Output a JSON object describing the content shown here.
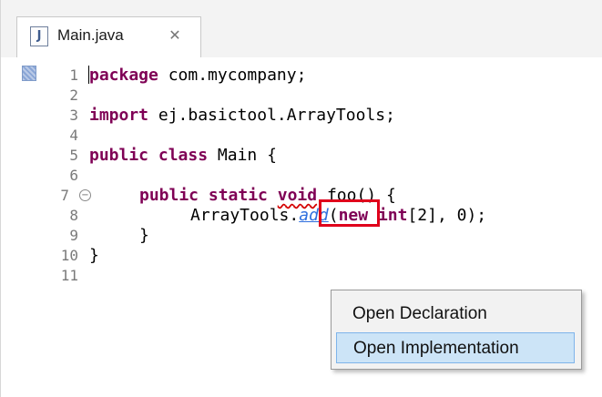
{
  "tab": {
    "icon": "java-file-icon",
    "icon_glyph": "J",
    "label": "Main.java",
    "close_icon": "close-x-icon",
    "close_glyph": "✕"
  },
  "editor": {
    "line_numbers": [
      "1",
      "2",
      "3",
      "4",
      "5",
      "6",
      "7",
      "8",
      "9",
      "10",
      "11"
    ],
    "fold_glyph": "−",
    "lines": {
      "l1_kw": "package",
      "l1_rest": " com.mycompany;",
      "l3_kw": "import",
      "l3_rest": " ej.basictool.ArrayTools;",
      "l5_kw1": "public",
      "l5_kw2": "class",
      "l5_rest": " Main {",
      "l7_kw1": "public",
      "l7_kw2": "static",
      "l7_kw3": "void",
      "l7_rest": " foo() {",
      "l8_pre": "ArrayTools.",
      "l8_method": "add",
      "l8_paren": "(",
      "l8_kw1": "new",
      "l8_kw2": "int",
      "l8_rest": "[2], 0);",
      "l9": "}",
      "l10": "}"
    }
  },
  "context_menu": {
    "items": [
      {
        "label": "Open Declaration",
        "selected": false
      },
      {
        "label": "Open Implementation",
        "selected": true
      }
    ]
  },
  "colors": {
    "keyword": "#7f0055",
    "link": "#2f6fde",
    "highlight_box": "#e0001b",
    "menu_selected": "#cce4f7"
  }
}
